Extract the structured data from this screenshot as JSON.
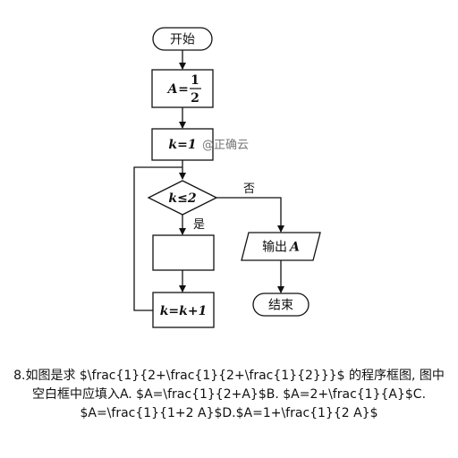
{
  "flowchart": {
    "start_label": "开始",
    "init_a": {
      "var": "A",
      "eq": "=",
      "num": "1",
      "den": "2"
    },
    "init_k": "k=1",
    "watermark": "@正确云",
    "condition": "k≤2",
    "no_label": "否",
    "yes_label": "是",
    "blank_box": "",
    "output_word": "输出",
    "output_var": "A",
    "increment": "k=k+1",
    "end_label": "结束"
  },
  "question": {
    "line1": "8.如图是求 $\\frac{1}{2+\\frac{1}{2+\\frac{1}{2}}}$ 的程序框图, 图中",
    "line2": "空白框中应填入A. $A=\\frac{1}{2+A}$B. $A=2+\\frac{1}{A}$C.",
    "line3": "$A=\\frac{1}{1+2 A}$D.$A=1+\\frac{1}{2 A}$"
  }
}
